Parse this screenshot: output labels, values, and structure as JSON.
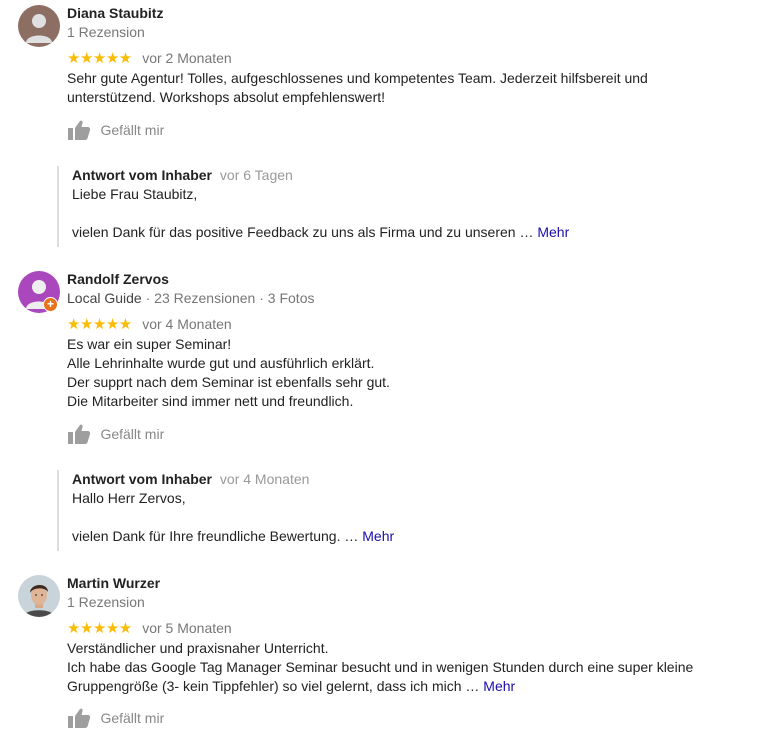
{
  "like_label": "Gefällt mir",
  "colors": {
    "star": "#fbbc04",
    "more_link": "#1a0dab",
    "local_guide_badge": "#e8711c"
  },
  "reviews": [
    {
      "name": "Diana Staubitz",
      "meta": "1 Rezension",
      "stars": "★★★★★",
      "rating": 5,
      "date": "vor 2 Monaten",
      "text_lines": [
        "Sehr gute Agentur! Tolles, aufgeschlossenes und kompetentes Team. Jederzeit hilfsbereit und",
        "unterstützend. Workshops absolut empfehlenswert!"
      ],
      "reply": {
        "owner_label": "Antwort vom Inhaber",
        "date": "vor 6 Tagen",
        "greeting": "Liebe Frau Staubitz,",
        "body": "vielen Dank für das positive Feedback zu uns als Firma und zu unseren …",
        "more": "Mehr"
      }
    },
    {
      "name": "Randolf Zervos",
      "meta_guide": "Local Guide",
      "meta_rest": " · 23 Rezensionen · 3 Fotos",
      "stars": "★★★★★",
      "rating": 5,
      "date": "vor 4 Monaten",
      "text_lines": [
        "Es war ein super Seminar!",
        "Alle Lehrinhalte wurde gut und ausführlich erklärt.",
        "Der supprt nach dem Seminar ist ebenfalls sehr gut.",
        "Die Mitarbeiter sind immer nett und freundlich."
      ],
      "reply": {
        "owner_label": "Antwort vom Inhaber",
        "date": "vor 4 Monaten",
        "greeting": "Hallo Herr Zervos,",
        "body": "vielen Dank für Ihre freundliche Bewertung. …",
        "more": "Mehr"
      }
    },
    {
      "name": "Martin Wurzer",
      "meta": "1 Rezension",
      "stars": "★★★★★",
      "rating": 5,
      "date": "vor 5 Monaten",
      "text_lines": [
        "Verständlicher und praxisnaher Unterricht.",
        "Ich habe das Google Tag Manager Seminar besucht und in wenigen Stunden durch eine super kleine"
      ],
      "text_last": "Gruppengröße (3- kein Tippfehler) so viel gelernt, dass ich mich …",
      "more": "Mehr"
    }
  ]
}
